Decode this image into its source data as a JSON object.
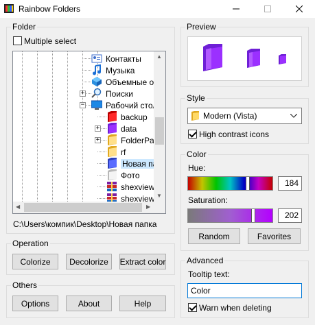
{
  "window": {
    "title": "Rainbow Folders"
  },
  "folder": {
    "group_title": "Folder",
    "multiple_select_label": "Multiple select",
    "multiple_select_checked": false,
    "tree_items": [
      {
        "label": "Контакты",
        "icon": "contacts-icon"
      },
      {
        "label": "Музыка",
        "icon": "music-icon"
      },
      {
        "label": "Объемные об",
        "icon": "3d-objects-icon"
      },
      {
        "label": "Поиски",
        "icon": "search-icon",
        "expander": "+"
      },
      {
        "label": "Рабочий стол",
        "icon": "desktop-icon",
        "expander": "−"
      },
      {
        "label": "backup",
        "icon": "folder-red-icon"
      },
      {
        "label": "data",
        "icon": "folder-purple-icon",
        "expander": "+"
      },
      {
        "label": "FolderPair",
        "icon": "folder-yellow-icon",
        "expander": "+"
      },
      {
        "label": "rf",
        "icon": "folder-yellow-icon"
      },
      {
        "label": "Новая па",
        "icon": "folder-blue-icon",
        "selected": true
      },
      {
        "label": "Фото",
        "icon": "folder-white-icon"
      },
      {
        "label": "shexview.",
        "icon": "archive-icon"
      },
      {
        "label": "shexview_",
        "icon": "archive-icon"
      }
    ],
    "path": "C:\\Users\\компик\\Desktop\\Новая папка"
  },
  "operation": {
    "group_title": "Operation",
    "colorize_label": "Colorize",
    "decolorize_label": "Decolorize",
    "extract_label": "Extract color"
  },
  "others": {
    "group_title": "Others",
    "options_label": "Options",
    "about_label": "About",
    "help_label": "Help"
  },
  "preview": {
    "group_title": "Preview",
    "folder_color": "#9b30ff"
  },
  "style": {
    "group_title": "Style",
    "selected": "Modern (Vista)",
    "high_contrast_label": "High contrast icons",
    "high_contrast_checked": true
  },
  "color": {
    "group_title": "Color",
    "hue_label": "Hue:",
    "hue_value": "184",
    "hue_fraction": 0.72,
    "saturation_label": "Saturation:",
    "saturation_value": "202",
    "saturation_fraction": 0.79,
    "random_label": "Random",
    "favorites_label": "Favorites"
  },
  "advanced": {
    "group_title": "Advanced",
    "tooltip_label": "Tooltip text:",
    "tooltip_value": "Color",
    "warn_label": "Warn when deleting",
    "warn_checked": true
  },
  "colors": {
    "accent": "#0078d7",
    "selection": "#cce8ff"
  }
}
